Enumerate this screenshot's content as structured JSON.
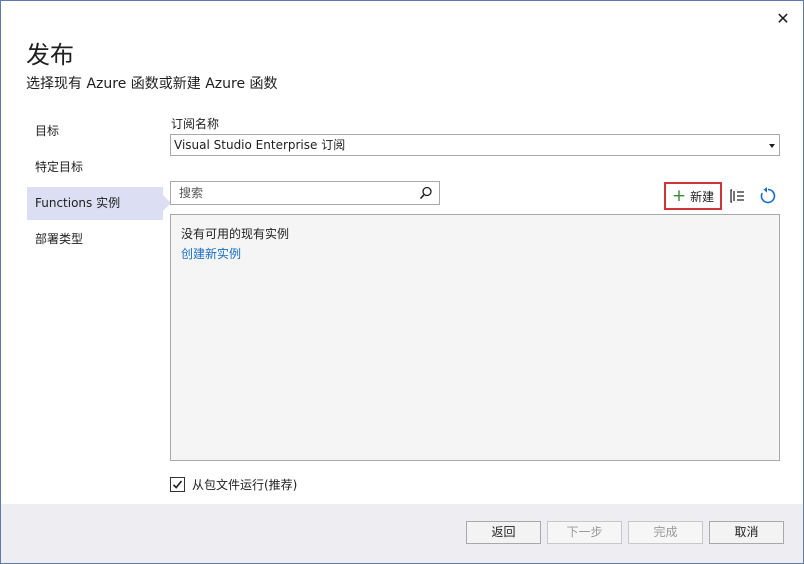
{
  "dialog": {
    "close_glyph": "✕",
    "title": "发布",
    "subtitle": "选择现有 Azure 函数或新建 Azure 函数"
  },
  "nav": {
    "items": [
      {
        "label": "目标",
        "active": false
      },
      {
        "label": "特定目标",
        "active": false
      },
      {
        "label": "Functions 实例",
        "active": true
      },
      {
        "label": "部署类型",
        "active": false
      }
    ]
  },
  "subscription": {
    "label": "订阅名称",
    "selected": "Visual Studio Enterprise 订阅"
  },
  "search": {
    "placeholder": "搜索",
    "value": ""
  },
  "toolbar": {
    "new_plus": "+",
    "new_label": "新建",
    "filter_icon": "filter-list-icon",
    "refresh_icon": "refresh-icon"
  },
  "instances": {
    "empty_message": "没有可用的现有实例",
    "create_link": "创建新实例"
  },
  "run_from_package": {
    "checked": true,
    "label": "从包文件运行(推荐)"
  },
  "footer": {
    "back": "返回",
    "next": "下一步",
    "finish": "完成",
    "cancel": "取消"
  },
  "colors": {
    "accent_border": "#d13438",
    "link": "#1a6ec5",
    "nav_active": "#dcdff4",
    "plus_green": "#388a34",
    "refresh_blue": "#1a6ec5"
  }
}
